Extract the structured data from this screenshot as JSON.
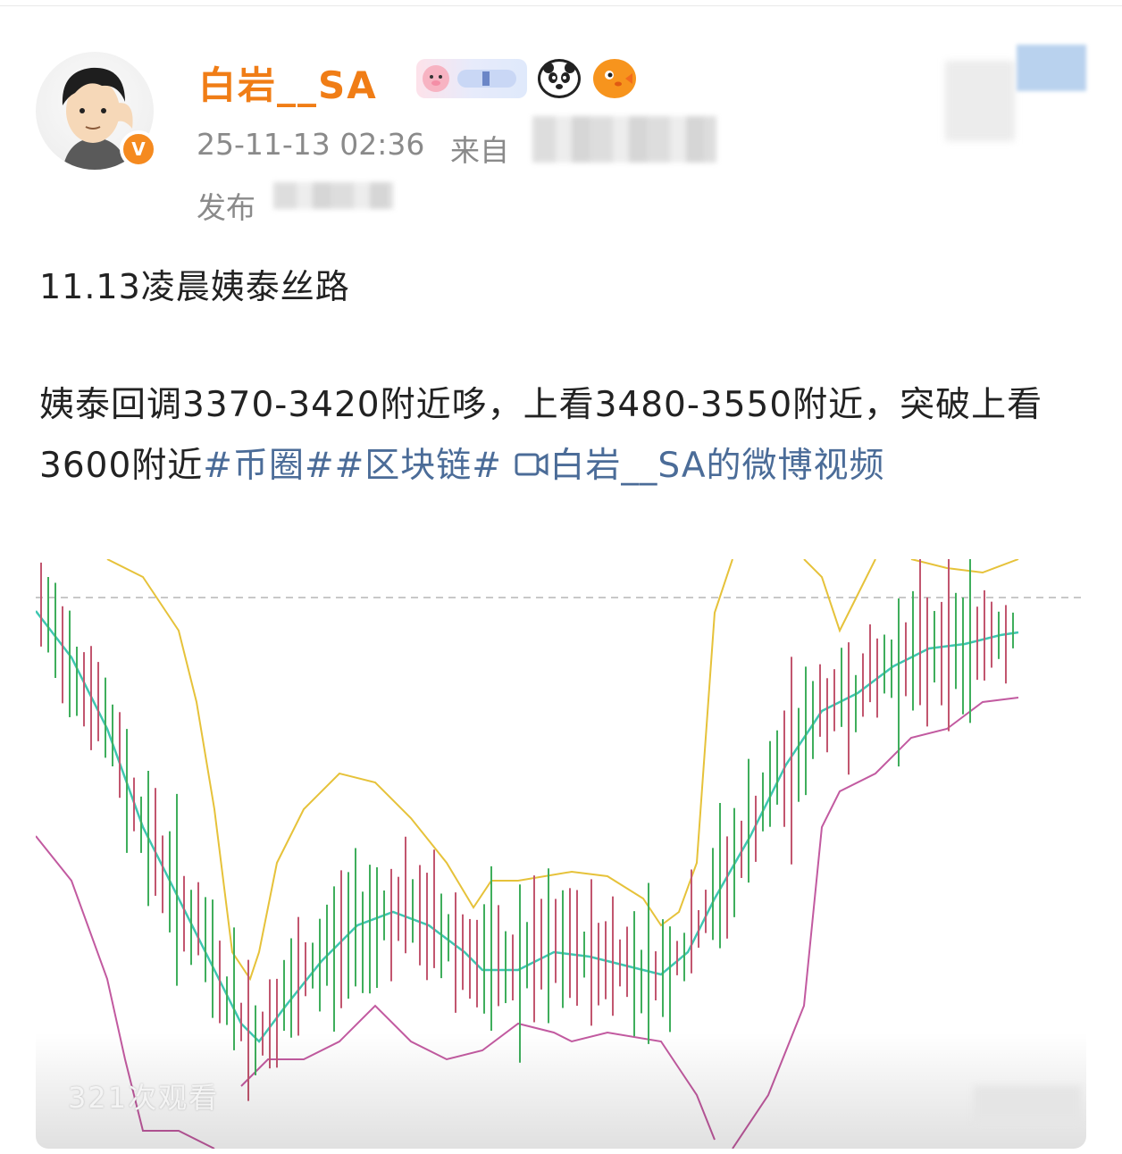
{
  "post": {
    "username": "白岩__SA",
    "verified_badge": "V",
    "timestamp": "25-11-13 02:36",
    "from_label": "来自",
    "publish_label": "发布",
    "title": "11.13凌晨姨泰丝路",
    "body_text": "姨泰回调3370-3420附近哆，上看3480-3550附近，突破上看3600附近",
    "tags": [
      "#币圈#",
      "#区块链#"
    ],
    "video_link": "白岩__SA的微博视频",
    "emojis": [
      "pig-badge-icon",
      "panda-icon",
      "pufferfish-icon"
    ]
  },
  "video": {
    "views_text": "321次观看",
    "chart_colors": {
      "up": "#3fae5c",
      "down": "#c2566f",
      "upper_band": "#e6c23a",
      "middle_band": "#3fc6b0",
      "lower_band": "#c25aa0",
      "ref_line": "#b5b5b5"
    }
  },
  "colors": {
    "username": "#f07d16",
    "link": "#4b6c98",
    "meta": "#8a8a8a"
  }
}
